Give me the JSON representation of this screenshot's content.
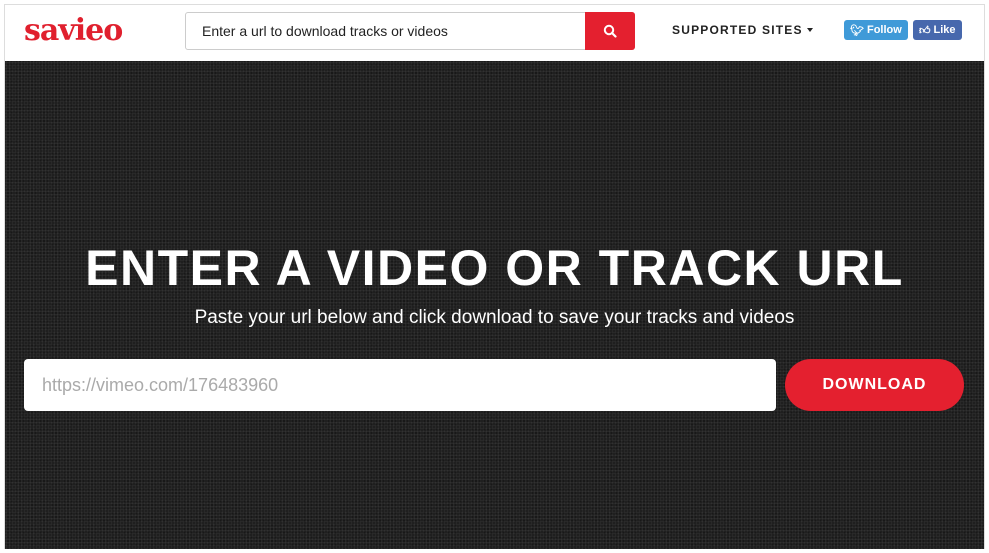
{
  "header": {
    "logo": "savieo",
    "search_placeholder": "Enter a url to download tracks or videos",
    "supported_sites": "SUPPORTED SITES",
    "twitter_follow": "Follow",
    "facebook_like": "Like"
  },
  "hero": {
    "title": "ENTER A VIDEO OR TRACK URL",
    "subtitle": "Paste your url below and click download to save your tracks and videos",
    "url_placeholder": "https://vimeo.com/176483960",
    "download_label": "DOWNLOAD"
  },
  "colors": {
    "accent": "#e4202f",
    "twitter": "#3f9ad8",
    "facebook": "#4768ad"
  }
}
